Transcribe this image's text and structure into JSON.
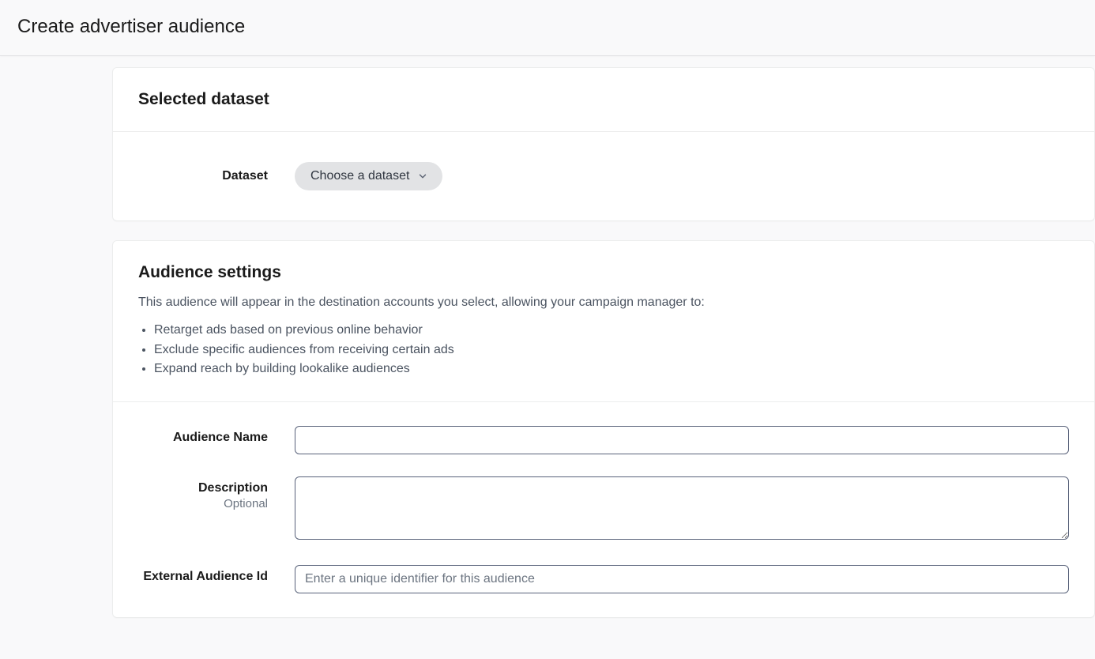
{
  "header": {
    "title": "Create advertiser audience"
  },
  "selectedDataset": {
    "title": "Selected dataset",
    "field": {
      "label": "Dataset",
      "selectText": "Choose a dataset"
    }
  },
  "audienceSettings": {
    "title": "Audience settings",
    "intro": "This audience will appear in the destination accounts you select, allowing your campaign manager to:",
    "bullets": [
      "Retarget ads based on previous online behavior",
      "Exclude specific audiences from receiving certain ads",
      "Expand reach by building lookalike audiences"
    ],
    "fields": {
      "audienceName": {
        "label": "Audience Name",
        "value": ""
      },
      "description": {
        "label": "Description",
        "optional": "Optional",
        "value": ""
      },
      "externalId": {
        "label": "External Audience Id",
        "placeholder": "Enter a unique identifier for this audience",
        "value": ""
      }
    }
  }
}
